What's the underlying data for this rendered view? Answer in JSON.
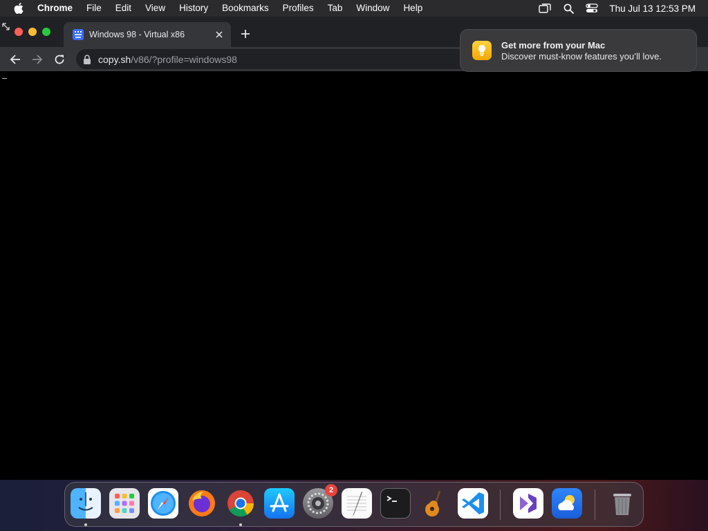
{
  "menubar": {
    "app_name": "Chrome",
    "menus": [
      "File",
      "Edit",
      "View",
      "History",
      "Bookmarks",
      "Profiles",
      "Tab",
      "Window",
      "Help"
    ],
    "clock": "Thu Jul 13  12:53 PM"
  },
  "browser": {
    "tab": {
      "title": "Windows 98 - Virtual x86"
    },
    "address": {
      "host": "copy.sh",
      "path": "/v86/?profile=windows98"
    }
  },
  "notification": {
    "title": "Get more from your Mac",
    "body": "Discover must-know features you’ll love."
  },
  "dock": {
    "items": [
      "finder",
      "launchpad",
      "safari",
      "firefox",
      "chrome",
      "app-store",
      "system-settings",
      "textedit",
      "terminal",
      "garageband",
      "vscode",
      "visual-studio",
      "weather",
      "trash"
    ],
    "system_settings_badge": "2"
  },
  "colors": {
    "accent_blue": "#1a73e8",
    "badge_red": "#e8453c"
  }
}
